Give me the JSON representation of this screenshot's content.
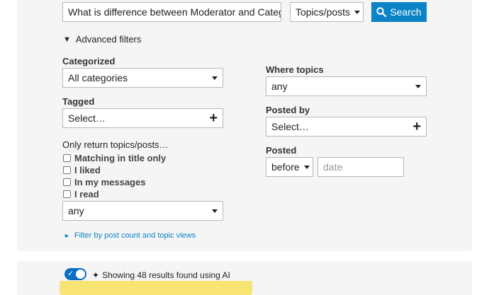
{
  "search": {
    "query": "What is difference between Moderator and Categor",
    "type_select": "Topics/posts",
    "button_label": "Search"
  },
  "advanced": {
    "toggle_label": "Advanced filters",
    "categorized_label": "Categorized",
    "categorized_value": "All categories",
    "tagged_label": "Tagged",
    "tagged_value": "Select…",
    "only_return_label": "Only return topics/posts…",
    "options": [
      "Matching in title only",
      "I liked",
      "In my messages",
      "I read"
    ],
    "only_return_select": "any",
    "where_topics_label": "Where topics",
    "where_topics_value": "any",
    "posted_by_label": "Posted by",
    "posted_by_value": "Select…",
    "posted_label": "Posted",
    "posted_when": "before",
    "date_placeholder": "date",
    "filter_link": "Filter by post count and topic views"
  },
  "ai": {
    "text": "Showing 48 results found using AI",
    "toggle_on": true
  },
  "colors": {
    "accent": "#0a84c6",
    "panel": "#f5f5f5",
    "highlight": "#f7e05a"
  }
}
